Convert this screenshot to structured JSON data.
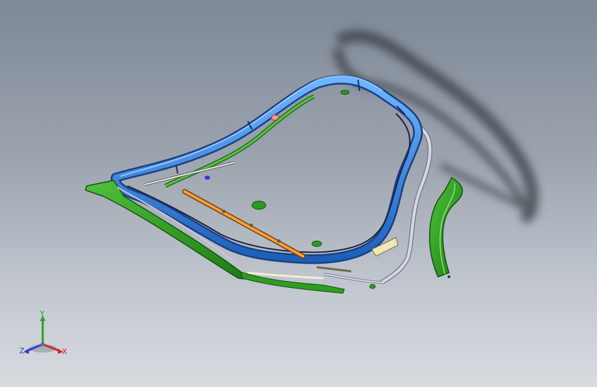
{
  "viewport": {
    "background_top": "#7e8896",
    "background_bottom": "#d8dbe0"
  },
  "model": {
    "colors": {
      "blue_seal": "#2f7fd8",
      "green_parts": "#2f9d22",
      "orange_bar": "#e58a2a",
      "gray_rail": "#b6b9c8",
      "shadow": "#3a3f47"
    }
  },
  "triad": {
    "x_label": "X",
    "y_label": "Y",
    "z_label": "Z",
    "colors": {
      "x": "#d02828",
      "y": "#2f9a2f",
      "z": "#3040c8"
    }
  }
}
